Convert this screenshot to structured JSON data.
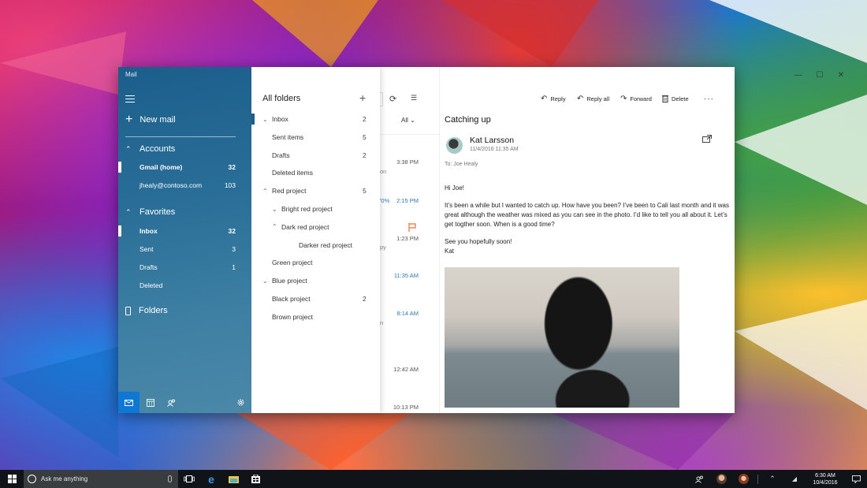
{
  "window": {
    "app_title": "Mail",
    "controls": {
      "minimize": "—",
      "maximize": "☐",
      "close": "✕"
    }
  },
  "sidebar": {
    "new_mail": "New mail",
    "accounts_header": "Accounts",
    "accounts": [
      {
        "label": "Gmail (home)",
        "count": "32",
        "selected": true
      },
      {
        "label": "jhealy@contoso.com",
        "count": "103",
        "selected": false
      }
    ],
    "favorites_header": "Favorites",
    "favorites": [
      {
        "label": "Inbox",
        "count": "32",
        "selected": true
      },
      {
        "label": "Sent",
        "count": "3"
      },
      {
        "label": "Drafts",
        "count": "1"
      },
      {
        "label": "Deleted",
        "count": ""
      }
    ],
    "folders_label": "Folders",
    "bottom_icons": [
      "mail-icon",
      "calendar-icon",
      "people-icon",
      "gear-icon"
    ]
  },
  "folder_pane": {
    "title": "All folders",
    "add_icon": "+",
    "folders": [
      {
        "label": "Inbox",
        "count": "2",
        "chevron": "down",
        "indent": 0,
        "selected": true
      },
      {
        "label": "Sent items",
        "count": "5",
        "chevron": "",
        "indent": 0
      },
      {
        "label": "Drafts",
        "count": "2",
        "chevron": "",
        "indent": 0
      },
      {
        "label": "Deleted items",
        "count": "",
        "chevron": "",
        "indent": 0
      },
      {
        "label": "Red project",
        "count": "5",
        "chevron": "up",
        "indent": 0
      },
      {
        "label": "Bright red project",
        "count": "",
        "chevron": "down",
        "indent": 1
      },
      {
        "label": "Dark red project",
        "count": "",
        "chevron": "up",
        "indent": 1
      },
      {
        "label": "Darker red project",
        "count": "",
        "chevron": "",
        "indent": 2
      },
      {
        "label": "Green project",
        "count": "",
        "chevron": "",
        "indent": 0
      },
      {
        "label": "Blue project",
        "count": "",
        "chevron": "down",
        "indent": 0
      },
      {
        "label": "Black project",
        "count": "2",
        "chevron": "",
        "indent": 0
      },
      {
        "label": "Brown project",
        "count": "",
        "chevron": "",
        "indent": 0
      }
    ]
  },
  "message_list": {
    "filter": "All",
    "times": [
      {
        "time": "3:38 PM",
        "fragment": "on",
        "blue": false
      },
      {
        "time": "2:15 PM",
        "fragment": "'0%",
        "blue": true
      },
      {
        "time": "1:23 PM",
        "fragment": "py",
        "blue": false,
        "flagged": true
      },
      {
        "time": "11:35 AM",
        "fragment": "",
        "blue": true
      },
      {
        "time": "8:14 AM",
        "fragment": "n",
        "blue": true
      },
      {
        "time": "12:42 AM",
        "fragment": "",
        "blue": false
      },
      {
        "time": "10:13 PM",
        "fragment": "",
        "blue": false
      }
    ]
  },
  "reading_pane": {
    "actions": {
      "reply": "Reply",
      "reply_all": "Reply all",
      "forward": "Forward",
      "delete": "Delete",
      "more": "···"
    },
    "subject": "Catching up",
    "sender": "Kat Larsson",
    "datetime": "11/4/2016 11:35 AM",
    "to": "To: Joe Healy",
    "greeting": "Hi Joe!",
    "body": "It’s been a while but I wanted to catch up. How have you been? I’ve been to Cali last month and it was great although the weather was mixed as you can see in the photo. I’d like to tell you all about it. Let’s get togther soon. When is a good time?",
    "closing": "See you hopefully soon!",
    "signature": "Kat"
  },
  "taskbar": {
    "search_placeholder": "Ask me anything",
    "time": "6:30 AM",
    "date": "10/4/2016"
  }
}
